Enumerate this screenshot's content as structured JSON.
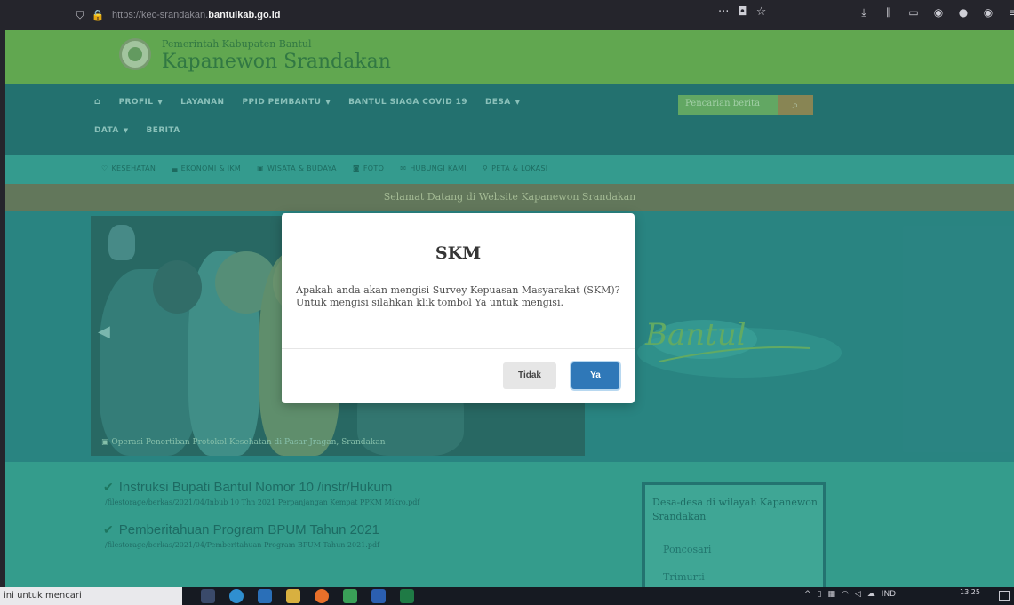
{
  "browser": {
    "url_prefix": "https://kec-srandakan.",
    "url_domain": "bantulkab.go.id",
    "more_icon": "more-dots-icon",
    "pocket_icon": "pocket-icon",
    "bookmark_icon": "star-icon",
    "toolbar_icons": [
      "download-icon",
      "library-icon",
      "sidebar-icon",
      "extension-icon",
      "account-icon",
      "menu-icon"
    ]
  },
  "site": {
    "gov_name": "Pemerintah Kabupaten Bantul",
    "district_name": "Kapanewon Srandakan",
    "nav_row1": [
      {
        "label": "PROFIL",
        "caret": true
      },
      {
        "label": "LAYANAN",
        "caret": false
      },
      {
        "label": "PPID PEMBANTU",
        "caret": true
      },
      {
        "label": "BANTUL SIAGA COVID 19",
        "caret": false
      },
      {
        "label": "DESA",
        "caret": true
      }
    ],
    "nav_row2": [
      {
        "label": "DATA",
        "caret": true
      },
      {
        "label": "BERITA",
        "caret": false
      }
    ],
    "search_placeholder": "Pencarian berita",
    "subnav": [
      "KESEHATAN",
      "EKONOMI & IKM",
      "WISATA & BUDAYA",
      "FOTO",
      "HUBUNGI KAMI",
      "PETA & LOKASI"
    ],
    "welcome": "Selamat Datang di Website Kapanewon Srandakan",
    "slide_caption": "Operasi Penertiban Protokol Kesehatan di Pasar Jragan, Srandakan",
    "bantul_text": "Bantul",
    "news": [
      {
        "title": "Instruksi Bupati Bantul Nomor 10 /instr/Hukum",
        "path": "/filestorage/berkas/2021/04/Inbub 10 Thn 2021 Perpanjangan Kempat PPKM Mikro.pdf"
      },
      {
        "title": "Pemberitahuan Program BPUM Tahun 2021",
        "path": "/filestorage/berkas/2021/04/Pemberitahuan Program BPUM Tahun 2021.pdf"
      }
    ],
    "sidebox_title": "Desa-desa di wilayah Kapanewon Srandakan",
    "sidebox_links": [
      "Poncosari",
      "Trimurti"
    ]
  },
  "modal": {
    "title": "SKM",
    "body": "Apakah anda akan mengisi Survey Kepuasan Masyarakat (SKM)? Untuk mengisi silahkan klik tombol Ya untuk mengisi.",
    "no_label": "Tidak",
    "yes_label": "Ya"
  },
  "taskbar": {
    "search_text": "ini untuk mencari",
    "language": "IND",
    "time": "13.25"
  }
}
